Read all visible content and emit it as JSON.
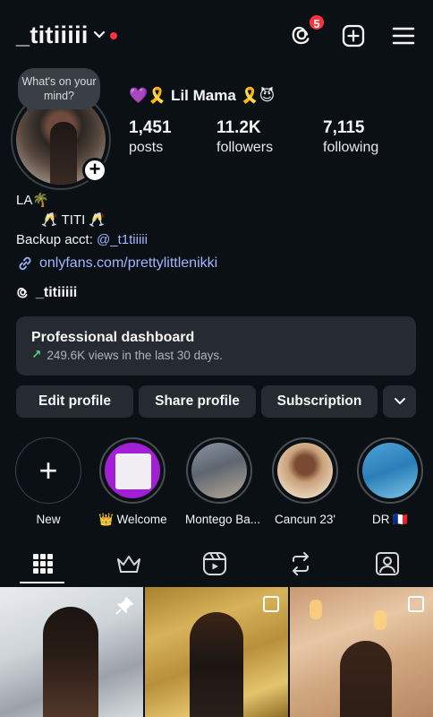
{
  "header": {
    "username": "_titiiiii",
    "threads_badge_count": "5"
  },
  "profile": {
    "note_text": "What's on your mind?",
    "display_name": "💜🎗️ Lil Mama 🎗️😈",
    "stats": [
      {
        "value": "1,451",
        "label": "posts"
      },
      {
        "value": "11.2K",
        "label": "followers"
      },
      {
        "value": "7,115",
        "label": "following"
      }
    ],
    "bio_line1": "LA🌴",
    "bio_line2": "🥂 TITI 🥂",
    "bio_line3_prefix": "Backup acct: ",
    "bio_line3_mention": "@_t1tiiiii",
    "link": "onlyfans.com/prettylittlenikki",
    "threads_handle": "_titiiiii"
  },
  "dashboard": {
    "title": "Professional dashboard",
    "subtitle": "249.6K views in the last 30 days."
  },
  "buttons": {
    "edit": "Edit profile",
    "share": "Share profile",
    "subscription": "Subscription"
  },
  "highlights": [
    {
      "label": "New"
    },
    {
      "label": "👑 Welcome"
    },
    {
      "label": "Montego Ba..."
    },
    {
      "label": "Cancun 23'"
    },
    {
      "label": "DR 🇫🇷"
    }
  ],
  "tabs": [
    "grid-icon",
    "crown-icon",
    "reels-icon",
    "reposts-icon",
    "tagged-icon"
  ],
  "colors": {
    "background": "#0b1014",
    "accent_link": "#a3b5ff",
    "notification_red": "#ff3040",
    "card": "#262b31"
  }
}
